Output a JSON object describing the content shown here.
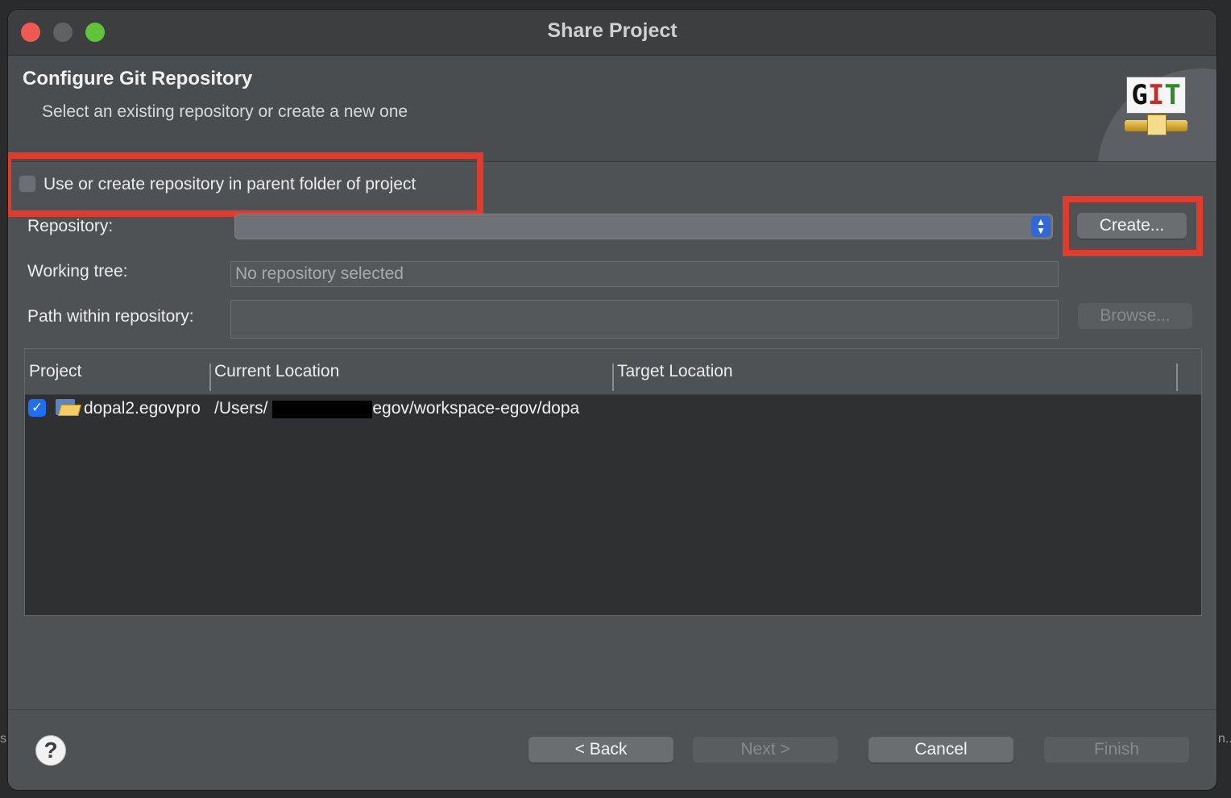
{
  "window": {
    "title": "Share Project",
    "traffic_lights": {
      "close_color": "#ee5a52",
      "minimize_color": "#606264",
      "zoom_color": "#5fc43b"
    }
  },
  "banner": {
    "title": "Configure Git Repository",
    "subtitle": "Select an existing repository or create a new one",
    "logo_text_g": "G",
    "logo_text_i": "I",
    "logo_text_t": "T"
  },
  "form": {
    "parent_folder_checkbox": {
      "label": "Use or create repository in parent folder of project",
      "checked": false
    },
    "repository_label": "Repository:",
    "repository_value": "",
    "create_button": "Create...",
    "working_tree_label": "Working tree:",
    "working_tree_value": "No repository selected",
    "path_label": "Path within repository:",
    "path_value": "",
    "browse_button": "Browse..."
  },
  "table": {
    "columns": [
      "Project",
      "Current Location",
      "Target Location"
    ],
    "rows": [
      {
        "checked": true,
        "project": "dopal2.egovpro",
        "current_location_prefix": "/Users/",
        "current_location_suffix": "/egov/workspace-egov/dopa",
        "target_location": ""
      }
    ]
  },
  "footer": {
    "back_button": "< Back",
    "next_button": "Next >",
    "cancel_button": "Cancel",
    "finish_button": "Finish"
  },
  "annotations": {
    "highlight_color": "#e23b2e"
  },
  "background_edge": {
    "left_glyph": "s",
    "right_glyph": "n..."
  }
}
